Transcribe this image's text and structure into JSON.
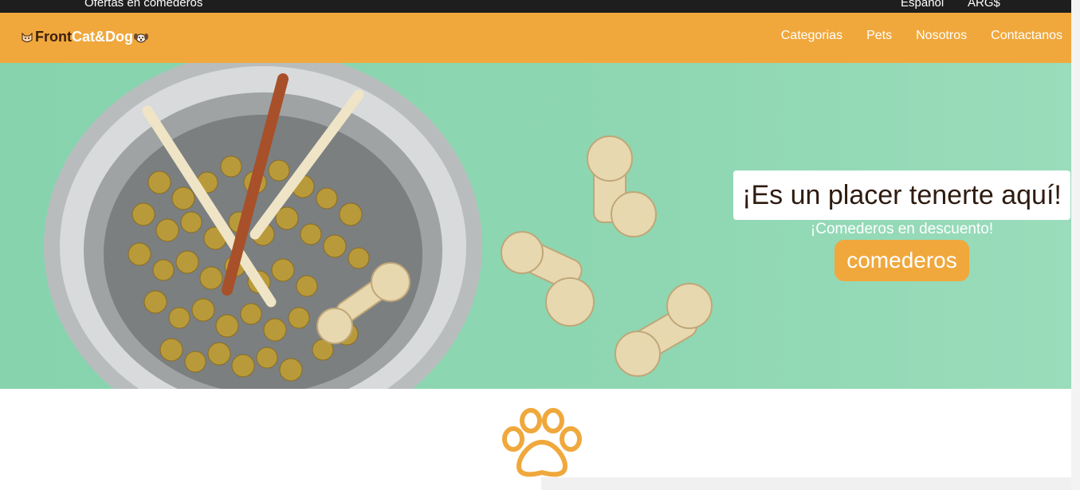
{
  "topbar": {
    "promo": "Ofertas en comederos",
    "language": "Espanol",
    "currency": "ARG$"
  },
  "brand": {
    "word1": "Front",
    "word2": "Cat&Dog"
  },
  "nav": {
    "items": [
      "Categorias",
      "Pets",
      "Nosotros",
      "Contactanos"
    ]
  },
  "hero": {
    "heading": "¡Es un placer tenerte aquí!",
    "subheading": "¡Comederos en descuento!",
    "cta_label": "comederos"
  },
  "colors": {
    "brand_orange": "#f0a83d",
    "topbar_black": "#1e1e1e",
    "hero_green": "#8ed7b2",
    "heading_brown": "#2e1b10"
  }
}
